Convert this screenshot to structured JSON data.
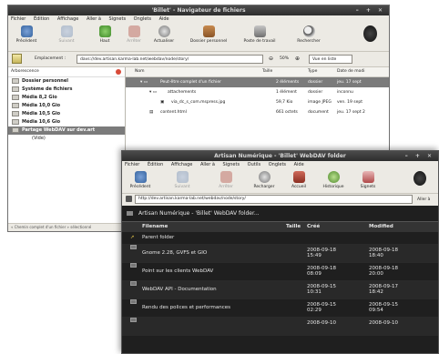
{
  "back_window": {
    "title": "'Billet' - Navigateur de fichiers",
    "menu": [
      "Fichier",
      "Édition",
      "Affichage",
      "Aller à",
      "Signets",
      "Onglets",
      "Aide"
    ],
    "toolbar": [
      "Précédent",
      "Suivant",
      "Haut",
      "Arrêter",
      "Actualiser",
      "Dossier personnel",
      "Poste de travail",
      "Rechercher"
    ],
    "location_label": "Emplacement :",
    "location_value": "davs://dev.artisan.karma-lab.net/webdav/node/story/",
    "zoom": "50%",
    "view_mode": "Vue en liste",
    "sidebar_header": "Arborescence",
    "sidebar_items": [
      "Dossier personnel",
      "Système de fichiers",
      "Média 8,2 Gio",
      "Média 10,0 Gio",
      "Média 10,5 Gio",
      "Média 10,6 Gio",
      "Partage WebDAV sur dev.art",
      "(Vide)"
    ],
    "columns": [
      "Nom",
      "Taille",
      "Type",
      "Date de modi"
    ],
    "files": [
      {
        "name": "Peut-être complet d'un fichier",
        "size": "2 éléments",
        "type": "dossier",
        "date": "jeu. 17 sept"
      },
      {
        "name": "attachements",
        "size": "1 élément",
        "type": "dossier",
        "date": "inconnu"
      },
      {
        "name": "via_dc_s_com.mspress.jpg",
        "size": "59,7 Kio",
        "type": "image JPEG",
        "date": "ven. 19 sept"
      },
      {
        "name": "content.html",
        "size": "661 octets",
        "type": "document",
        "date": "jeu. 17 sept 2"
      }
    ],
    "status": "« Chemin complet d'un fichier » sélectionné"
  },
  "front_window": {
    "title": "Artisan Numérique - 'Billet' WebDAV folder",
    "menu": [
      "Fichier",
      "Édition",
      "Affichage",
      "Aller à",
      "Signets",
      "Outils",
      "Onglets",
      "Aide"
    ],
    "toolbar": [
      "Précédent",
      "Suivant",
      "Arrêter",
      "Recharger",
      "Accueil",
      "Historique",
      "Signets"
    ],
    "address": "http://dev.artisan.karma-lab.net/webdav/node/story/",
    "go_label": "Aller à",
    "page_title": "Artisan Numérique - 'Billet' WebDAV folder...",
    "columns": [
      "Filename",
      "Taille",
      "Créé",
      "Modified"
    ],
    "parent_label": "Parent folder",
    "rows": [
      {
        "name": "Gnome 2.28, GVFS et GIO",
        "created": "2008-09-18 15:49",
        "modified": "2008-09-18 18:40"
      },
      {
        "name": "Point sur les clients WebDAV",
        "created": "2008-09-18 08:09",
        "modified": "2008-09-18 20:00"
      },
      {
        "name": "WebDAV API - Documentation",
        "created": "2008-09-15 10:31",
        "modified": "2008-09-17 18:42"
      },
      {
        "name": "Rendu des polices et performances",
        "created": "2008-09-15 02:29",
        "modified": "2008-09-15 09:54"
      },
      {
        "name": "",
        "created": "2008-09-10",
        "modified": "2008-09-10"
      }
    ]
  }
}
